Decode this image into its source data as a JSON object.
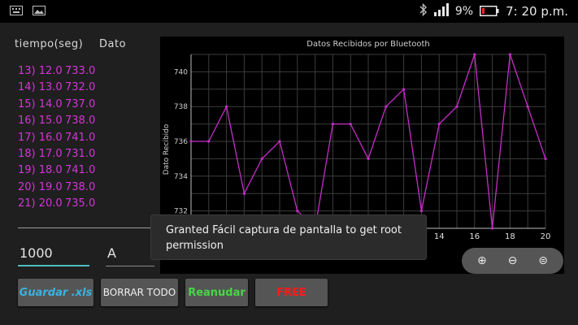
{
  "status_bar": {
    "battery_percent": "9%",
    "time": "7: 20 p.m.",
    "icons": [
      "keyboard-icon",
      "image-icon",
      "bluetooth-icon",
      "signal-icon",
      "battery-icon"
    ]
  },
  "headers": {
    "time": "tiempo(seg)",
    "value": "Dato"
  },
  "readings": [
    {
      "t": "13) 12.0",
      "v": "733.0"
    },
    {
      "t": "14) 13.0",
      "v": "732.0"
    },
    {
      "t": "15) 14.0",
      "v": "737.0"
    },
    {
      "t": "16) 15.0",
      "v": "738.0"
    },
    {
      "t": "17) 16.0",
      "v": "741.0"
    },
    {
      "t": "18) 17.0",
      "v": "731.0"
    },
    {
      "t": "19) 18.0",
      "v": "741.0"
    },
    {
      "t": "20) 19.0",
      "v": "738.0"
    },
    {
      "t": "21) 20.0",
      "v": "735.0"
    }
  ],
  "inputs": {
    "interval_value": "1000",
    "letter_value": "A"
  },
  "chart_data": {
    "type": "line",
    "title": "Datos Recibidos por Bluetooth",
    "ylabel": "Dato Recibido",
    "xlabel": "",
    "xlim": [
      0,
      20
    ],
    "ylim": [
      731,
      741
    ],
    "y_ticks": [
      732,
      734,
      736,
      738,
      740
    ],
    "x_ticks_visible": [
      14,
      16,
      18,
      20
    ],
    "grid": true,
    "series": [
      {
        "color": "#c52ec8",
        "x": [
          0,
          1,
          2,
          3,
          4,
          5,
          6,
          7,
          8,
          9,
          10,
          11,
          12,
          13,
          14,
          15,
          16,
          17,
          18,
          19,
          20
        ],
        "values": [
          736,
          736,
          738,
          733,
          735,
          736,
          732,
          731,
          737,
          737,
          735,
          738,
          739,
          732,
          737,
          738,
          741,
          731,
          741,
          738,
          735
        ]
      }
    ]
  },
  "zoom_controls": {
    "zoom_in": "⊕",
    "zoom_out": "⊖",
    "reset": "⊜"
  },
  "toast": {
    "message": "Granted Fácil captura de pantalla to get root permission"
  },
  "buttons": {
    "save": "Guardar .xls",
    "clear": "BORRAR TODO",
    "resume": "Reanudar",
    "stop": "FREE"
  },
  "colors": {
    "accent": "#4dbdbd",
    "series": "#c52ec8",
    "list_text": "#d236d6",
    "save": "#3ab3dd",
    "resume": "#48d648",
    "stop": "#ff1a1a"
  }
}
